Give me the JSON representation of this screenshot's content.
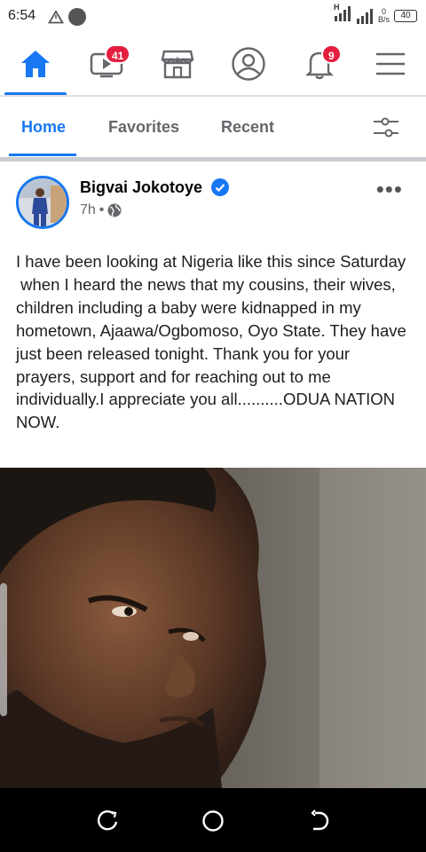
{
  "status_bar": {
    "time": "6:54",
    "network_type": "H",
    "speed_value": "0",
    "speed_unit": "B/s",
    "battery": "40"
  },
  "top_nav": {
    "items": [
      {
        "icon": "home-icon",
        "active": true
      },
      {
        "icon": "watch-video-icon",
        "badge": "41"
      },
      {
        "icon": "marketplace-icon"
      },
      {
        "icon": "profile-icon"
      },
      {
        "icon": "notifications-bell-icon",
        "badge": "9"
      },
      {
        "icon": "menu-icon"
      }
    ]
  },
  "feed_tabs": {
    "items": [
      "Home",
      "Favorites",
      "Recent"
    ],
    "active": "Home",
    "filter_icon": "filter-sliders-icon"
  },
  "post": {
    "author": "Bigvai Jokotoye",
    "verified": true,
    "time": "7h",
    "separator": "•",
    "audience_icon": "globe-icon",
    "more_label": "•••",
    "text": "I have been looking at Nigeria like this since Saturday\n when I heard the news that my cousins, their wives, children including a baby were kidnapped in my hometown, Ajaawa/Ogbomoso, Oyo State. They have just been released tonight. Thank you for your prayers, support and for reaching out to me individually.I appreciate you all..........ODUA NATION NOW."
  },
  "colors": {
    "accent": "#1877f2",
    "badge": "#e41e3f",
    "inactive": "#65676b"
  }
}
